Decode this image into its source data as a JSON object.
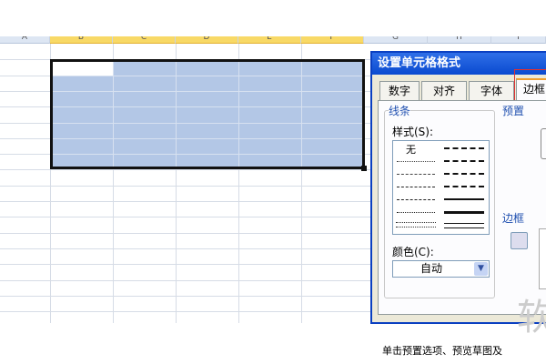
{
  "sheet": {
    "columns": [
      "A",
      "B",
      "C",
      "D",
      "E",
      "F",
      "G",
      "H",
      "I"
    ],
    "selected_columns": [
      "B",
      "C",
      "D",
      "E",
      "F"
    ]
  },
  "dialog": {
    "title": "设置单元格格式",
    "tabs": [
      "数字",
      "对齐",
      "字体",
      "边框"
    ],
    "active_tab": "边框",
    "line_group": "线条",
    "style_label": "样式(S):",
    "style_none": "无",
    "color_label": "颜色(C):",
    "color_value": "自动",
    "preset_label": "预置",
    "border_label": "边框",
    "hint": "单击预置选项、预览草图及",
    "watermark": "软"
  }
}
